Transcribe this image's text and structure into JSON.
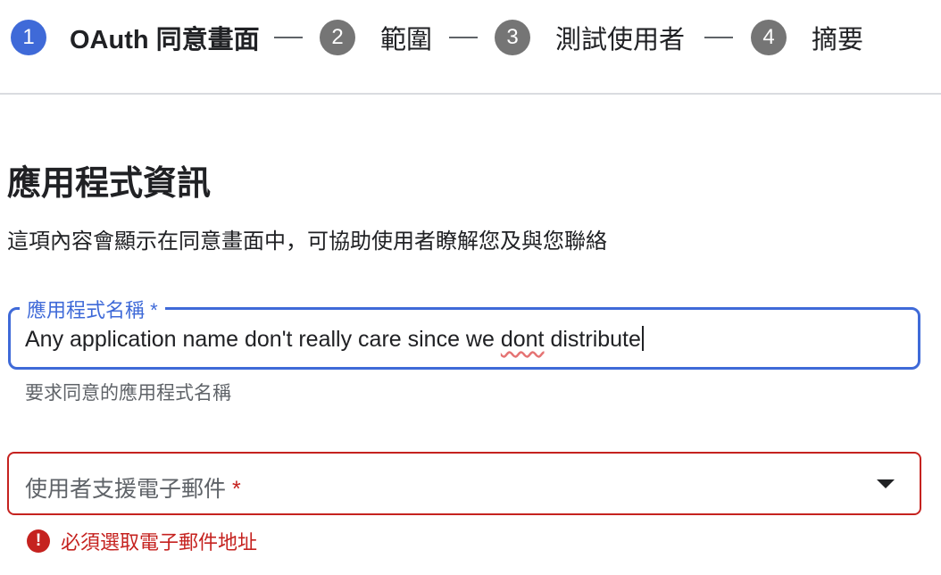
{
  "stepper": {
    "steps": [
      {
        "number": "1",
        "label": "OAuth 同意畫面",
        "active": true
      },
      {
        "number": "2",
        "label": "範圍",
        "active": false
      },
      {
        "number": "3",
        "label": "測試使用者",
        "active": false
      },
      {
        "number": "4",
        "label": "摘要",
        "active": false
      }
    ]
  },
  "section": {
    "title": "應用程式資訊",
    "description": "這項內容會顯示在同意畫面中，可協助使用者瞭解您及與您聯絡"
  },
  "app_name_field": {
    "label": "應用程式名稱 *",
    "value_before": "Any application name don't really care since we ",
    "value_misspelled": "dont",
    "value_after": " distribute",
    "helper": "要求同意的應用程式名稱"
  },
  "email_field": {
    "placeholder": "使用者支援電子郵件",
    "required_mark": "*",
    "error_icon": "!",
    "error": "必須選取電子郵件地址"
  },
  "colors": {
    "accent": "#3f6ad8",
    "error": "#c5221f",
    "inactive_step": "#757575"
  }
}
